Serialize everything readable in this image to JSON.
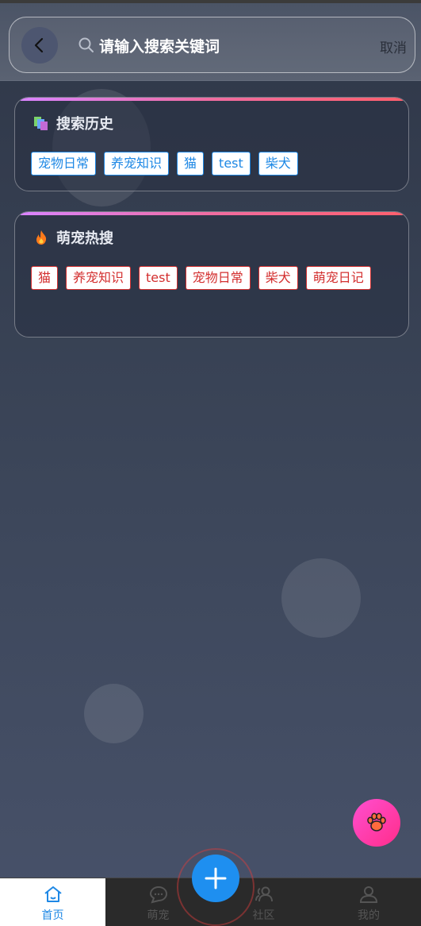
{
  "header": {
    "search_placeholder": "请输入搜索关键词",
    "cancel_label": "取消"
  },
  "history": {
    "title": "搜索历史",
    "tags": [
      "宠物日常",
      "养宠知识",
      "猫",
      "test",
      "柴犬"
    ]
  },
  "hot": {
    "title": "萌宠热搜",
    "tags": [
      "猫",
      "养宠知识",
      "test",
      "宠物日常",
      "柴犬",
      "萌宠日记"
    ]
  },
  "tabbar": {
    "items": [
      {
        "label": "首页",
        "icon": "home-icon",
        "active": true
      },
      {
        "label": "萌宠",
        "icon": "chat-icon",
        "active": false
      },
      {
        "label": "社区",
        "icon": "community-icon",
        "active": false
      },
      {
        "label": "我的",
        "icon": "user-icon",
        "active": false
      }
    ]
  },
  "colors": {
    "accent": "#1e88e5",
    "hot_tag": "#d32f2f",
    "fab_pink": "#ff2d8a"
  }
}
